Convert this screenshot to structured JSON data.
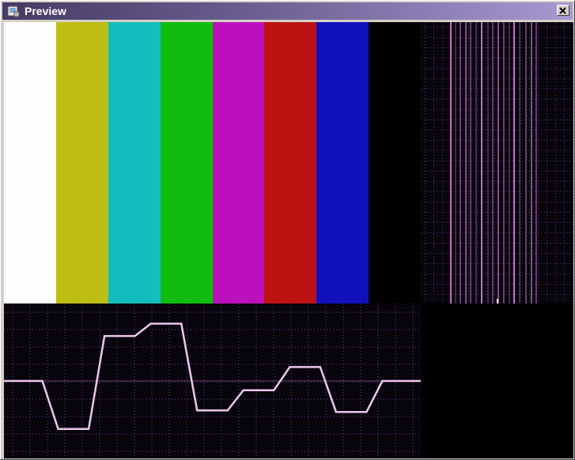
{
  "window": {
    "title": "Preview",
    "icons": {
      "app": "preview-app-icon",
      "close": "close-icon"
    }
  },
  "colorbars": {
    "colors": [
      "#fefefe",
      "#bdbd12",
      "#12bdbd",
      "#10bc10",
      "#bd10bd",
      "#bd1212",
      "#1010bd",
      "#000000"
    ]
  },
  "waveform": {
    "trace_color": "#ecc6ec",
    "levels": [
      0.5,
      0.19,
      0.79,
      0.87,
      0.31,
      0.44,
      0.59,
      0.3,
      0.5
    ]
  },
  "vectorscope": {
    "trace_color": "#d97cd9"
  }
}
